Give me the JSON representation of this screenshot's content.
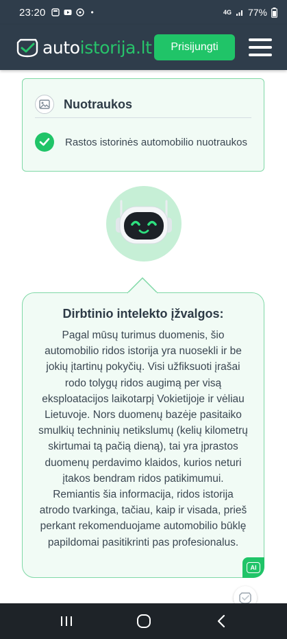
{
  "status_bar": {
    "time": "23:20",
    "dot": "•",
    "battery": "77%",
    "network_label": "4G",
    "icons": [
      "notification-icon",
      "youtube-icon",
      "messenger-icon",
      "network-4g-icon",
      "signal-icon",
      "battery-icon"
    ]
  },
  "header": {
    "logo_part1": "auto",
    "logo_part2": "istorija.lt",
    "login_label": "Prisijungti",
    "menu_icon": "hamburger-menu-icon"
  },
  "photos_card": {
    "title": "Nuotraukos",
    "icon": "image-icon",
    "item_text": "Rastos istorinės automobilio nuotraukos",
    "item_icon": "check-circle-icon"
  },
  "ai_section": {
    "robot_icon": "robot-icon",
    "title": "Dirbtinio intelekto įžvalgos:",
    "text": "Pagal mūsų turimus duomenis, šio automobilio ridos istorija yra nuosekli ir be jokių įtartinų pokyčių. Visi užfiksuoti įrašai rodo tolygų ridos augimą per visą eksploatacijos laikotarpį Vokietijoje ir vėliau Lietuvoje. Nors duomenų bazėje pasitaiko smulkių techninių netikslumų (kelių kilometrų skirtumai tą pačią dieną), tai yra įprastos duomenų perdavimo klaidos, kurios neturi įtakos bendram ridos patikimumui. Remiantis šia informacija, ridos istorija atrodo tvarkinga, tačiau, kaip ir visada, prieš perkant rekomenduojame automobilio būklę papildomai pasitikrinti pas profesionalus.",
    "badge_label": "AI"
  },
  "colors": {
    "header_bg": "#2f3d4b",
    "accent_green": "#20c468",
    "card_bg": "#f1fbf5",
    "card_border": "#7fd8a6"
  },
  "nav_bar": {
    "buttons": [
      "recent-apps-icon",
      "home-icon",
      "back-icon"
    ]
  }
}
